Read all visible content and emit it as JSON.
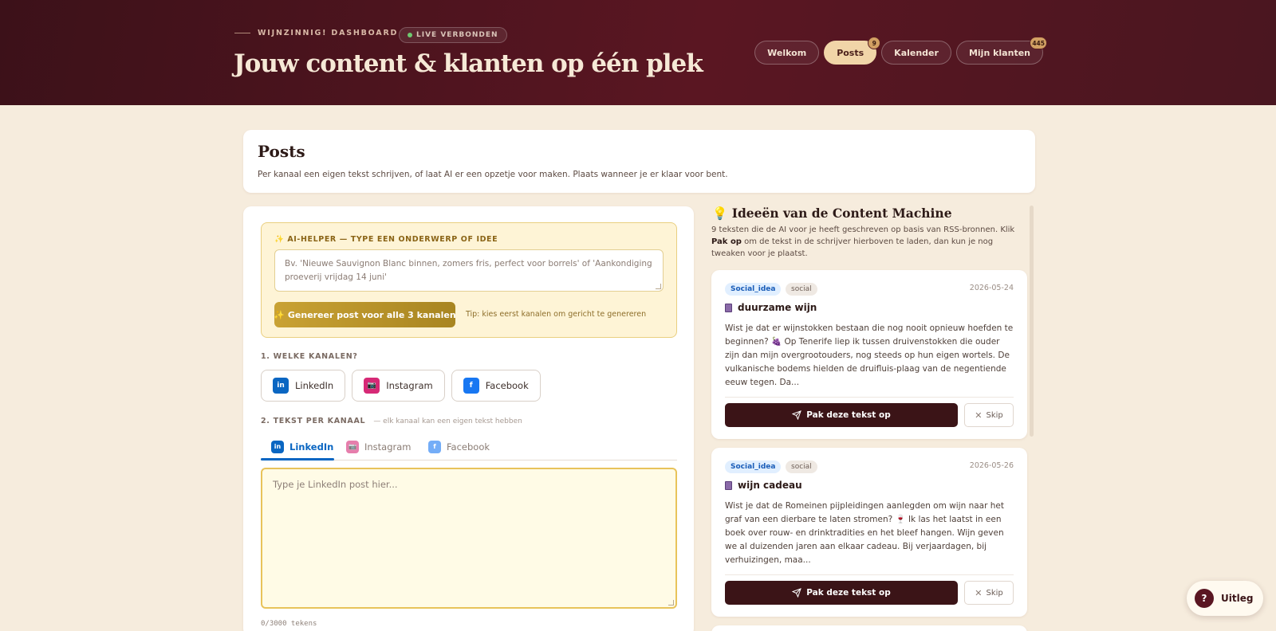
{
  "header": {
    "eyebrow": "WIJNZINNIG! DASHBOARD",
    "live_status": "LIVE VERBONDEN",
    "title": "Jouw content & klanten op één plek",
    "nav": [
      {
        "label": "Welkom",
        "count": ""
      },
      {
        "label": "Posts",
        "count": "9"
      },
      {
        "label": "Kalender",
        "count": ""
      },
      {
        "label": "Mijn klanten",
        "count": "445"
      }
    ]
  },
  "intro": {
    "title": "Posts",
    "subtitle": "Per kanaal een eigen tekst schrijven, of laat AI er een opzetje voor maken. Plaats wanneer je er klaar voor bent."
  },
  "ai_helper": {
    "label": "✨ AI-HELPER — TYPE EEN ONDERWERP OF IDEE",
    "placeholder": "Bv. 'Nieuwe Sauvignon Blanc binnen, zomers fris, perfect voor borrels' of 'Aankondiging proeverij vrijdag 14 juni'",
    "generate_label": "✨ Genereer post voor alle 3 kanalen",
    "tip": "Tip: kies eerst kanalen om gericht te genereren"
  },
  "channels": {
    "section_label": "1. WELKE KANALEN?",
    "items": [
      {
        "label": "LinkedIn",
        "icon": "in",
        "color": "#0a66c2"
      },
      {
        "label": "Instagram",
        "icon": "📷",
        "color": "#d62976"
      },
      {
        "label": "Facebook",
        "icon": "f",
        "color": "#1877f2"
      }
    ]
  },
  "text_per_channel": {
    "section_label": "2. TEKST PER KANAAL",
    "hint": "— elk kanaal kan een eigen tekst hebben",
    "tabs": [
      "LinkedIn",
      "Instagram",
      "Facebook"
    ],
    "placeholder": "Type je LinkedIn post hier...",
    "char_count": "0/3000 tekens"
  },
  "ideas": {
    "title": "💡 Ideeën van de Content Machine",
    "subtitle_before": "9 teksten die de AI voor je heeft geschreven op basis van RSS-bronnen. Klik ",
    "subtitle_bold": "Pak op",
    "subtitle_after": " om de tekst in de schrijver hierboven te laden, dan kun je nog tweaken voor je plaatst.",
    "pick_label": "Pak deze tekst op",
    "skip_label": "Skip",
    "cards": [
      {
        "type": "Social_idea",
        "kind": "social",
        "date": "2026-05-24",
        "title": "duurzame wijn",
        "body": "Wist je dat er wijnstokken bestaan die nog nooit opnieuw hoefden te beginnen? 🍇 Op Tenerife liep ik tussen druivenstokken die ouder zijn dan mijn overgrootouders, nog steeds op hun eigen wortels. De vulkanische bodems hielden de druifluis-plaag van de negentiende eeuw tegen. Da..."
      },
      {
        "type": "Social_idea",
        "kind": "social",
        "date": "2026-05-26",
        "title": "wijn cadeau",
        "body": "Wist je dat de Romeinen pijpleidingen aanlegden om wijn naar het graf van een dierbare te laten stromen? 🍷 Ik las het laatst in een boek over rouw- en drinktradities en het bleef hangen. Wijn geven we al duizenden jaren aan elkaar cadeau. Bij verjaardagen, bij verhuizingen, maa..."
      }
    ]
  },
  "help": {
    "label": "Uitleg",
    "icon": "?"
  }
}
